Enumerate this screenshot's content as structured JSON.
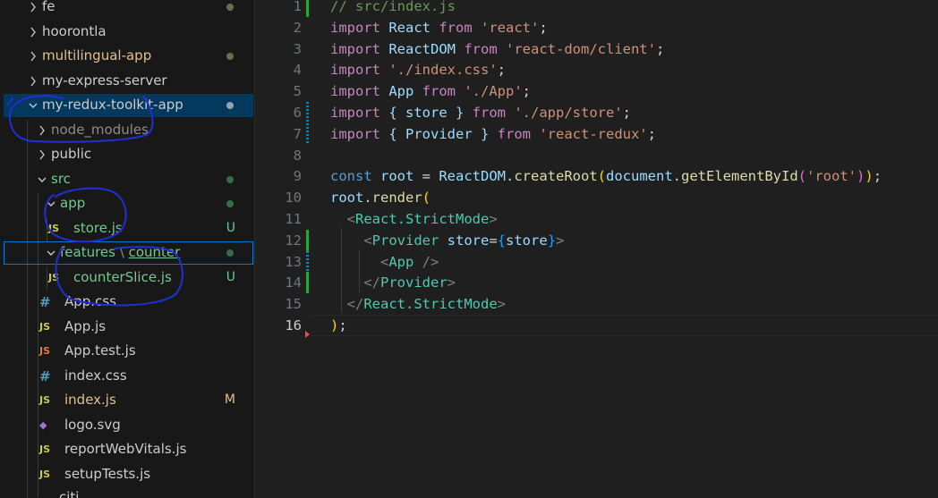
{
  "explorer": {
    "rows": [
      {
        "label": "fe",
        "kind": "folder",
        "open": false,
        "depth": 0,
        "dot": "#6f6a52"
      },
      {
        "label": "hoorontla",
        "kind": "folder",
        "open": false,
        "depth": 0
      },
      {
        "label": "multilingual-app",
        "kind": "folder",
        "open": false,
        "depth": 0,
        "dot": "#6f6a52",
        "status": "mod"
      },
      {
        "label": "my-express-server",
        "kind": "folder",
        "open": false,
        "depth": 0
      },
      {
        "label": "my-redux-toolkit-app",
        "kind": "folder",
        "open": true,
        "depth": 0,
        "dot": "#8fa5b4",
        "selected": true
      },
      {
        "label": "node_modules",
        "kind": "folder",
        "open": false,
        "depth": 1,
        "status": "dim"
      },
      {
        "label": "public",
        "kind": "folder",
        "open": false,
        "depth": 1
      },
      {
        "label": "src",
        "kind": "folder",
        "open": true,
        "depth": 1,
        "dot": "#376b4a",
        "status": "untr"
      },
      {
        "label": "app",
        "kind": "folder",
        "open": true,
        "depth": 2,
        "dot": "#376b4a",
        "status": "untr"
      },
      {
        "label": "store.js",
        "kind": "file",
        "icon": "JS",
        "iconType": "js",
        "depth": 3,
        "badge": "U",
        "status": "untr"
      },
      {
        "label": "features",
        "label2": "counter",
        "kind": "folder",
        "open": true,
        "depth": 2,
        "dot": "#376b4a",
        "status": "untr",
        "focused": true
      },
      {
        "label": "counterSlice.js",
        "kind": "file",
        "icon": "JS",
        "iconType": "js",
        "depth": 3,
        "badge": "U",
        "status": "untr"
      },
      {
        "label": "App.css",
        "kind": "file",
        "icon": "#",
        "iconType": "css",
        "depth": 2
      },
      {
        "label": "App.js",
        "kind": "file",
        "icon": "JS",
        "iconType": "js",
        "depth": 2
      },
      {
        "label": "App.test.js",
        "kind": "file",
        "icon": "JS",
        "iconType": "test",
        "depth": 2
      },
      {
        "label": "index.css",
        "kind": "file",
        "icon": "#",
        "iconType": "css",
        "depth": 2
      },
      {
        "label": "index.js",
        "kind": "file",
        "icon": "JS",
        "iconType": "js",
        "depth": 2,
        "badge": "M",
        "status": "mod"
      },
      {
        "label": "logo.svg",
        "kind": "file",
        "icon": "◆",
        "iconType": "svg",
        "depth": 2
      },
      {
        "label": "reportWebVitals.js",
        "kind": "file",
        "icon": "JS",
        "iconType": "js",
        "depth": 2
      },
      {
        "label": "setupTests.js",
        "kind": "file",
        "icon": "JS",
        "iconType": "js",
        "depth": 2
      }
    ]
  },
  "editor": {
    "current_line": 16,
    "lines": [
      {
        "n": "1",
        "git": "add",
        "tokens": [
          [
            "// src/index.js",
            "cm"
          ]
        ]
      },
      {
        "n": "2",
        "tokens": [
          [
            "import",
            "kw"
          ],
          [
            " React ",
            "id"
          ],
          [
            "from",
            "kw"
          ],
          [
            " ",
            "txt"
          ],
          [
            "'react'",
            "str"
          ],
          [
            ";",
            "txt"
          ]
        ]
      },
      {
        "n": "3",
        "tokens": [
          [
            "import",
            "kw"
          ],
          [
            " ReactDOM ",
            "id"
          ],
          [
            "from",
            "kw"
          ],
          [
            " ",
            "txt"
          ],
          [
            "'react-dom/client'",
            "str"
          ],
          [
            ";",
            "txt"
          ]
        ]
      },
      {
        "n": "4",
        "tokens": [
          [
            "import",
            "kw"
          ],
          [
            " ",
            "txt"
          ],
          [
            "'./index.css'",
            "str"
          ],
          [
            ";",
            "txt"
          ]
        ]
      },
      {
        "n": "5",
        "tokens": [
          [
            "import",
            "kw"
          ],
          [
            " App ",
            "id"
          ],
          [
            "from",
            "kw"
          ],
          [
            " ",
            "txt"
          ],
          [
            "'./App'",
            "str"
          ],
          [
            ";",
            "txt"
          ]
        ]
      },
      {
        "n": "6",
        "git": "mod",
        "tokens": [
          [
            "import",
            "kw"
          ],
          [
            " { store } ",
            "id"
          ],
          [
            "from",
            "kw"
          ],
          [
            " ",
            "txt"
          ],
          [
            "'./app/store'",
            "str"
          ],
          [
            ";",
            "txt"
          ]
        ]
      },
      {
        "n": "7",
        "git": "mod",
        "tokens": [
          [
            "import",
            "kw"
          ],
          [
            " { Provider } ",
            "id"
          ],
          [
            "from",
            "kw"
          ],
          [
            " ",
            "txt"
          ],
          [
            "'react-redux'",
            "str"
          ],
          [
            ";",
            "txt"
          ]
        ]
      },
      {
        "n": "8",
        "tokens": []
      },
      {
        "n": "9",
        "tokens": [
          [
            "const",
            "bl"
          ],
          [
            " root ",
            "id"
          ],
          [
            "= ",
            "txt"
          ],
          [
            "ReactDOM",
            "id"
          ],
          [
            ".",
            "txt"
          ],
          [
            "createRoot",
            "fn"
          ],
          [
            "(",
            "b1"
          ],
          [
            "document",
            "id"
          ],
          [
            ".",
            "txt"
          ],
          [
            "getElementById",
            "fn"
          ],
          [
            "(",
            "b2"
          ],
          [
            "'root'",
            "str"
          ],
          [
            ")",
            "b2"
          ],
          [
            ")",
            "b1"
          ],
          [
            ";",
            "txt"
          ]
        ]
      },
      {
        "n": "10",
        "tokens": [
          [
            "root",
            "id"
          ],
          [
            ".",
            "txt"
          ],
          [
            "render",
            "fn"
          ],
          [
            "(",
            "b1"
          ]
        ]
      },
      {
        "n": "11",
        "tokens": [
          [
            "  ",
            "txt"
          ],
          [
            "<",
            "pun"
          ],
          [
            "React.StrictMode",
            "tag"
          ],
          [
            ">",
            "pun"
          ]
        ]
      },
      {
        "n": "12",
        "git": "add",
        "tokens": [
          [
            "    ",
            "txt"
          ],
          [
            "<",
            "pun"
          ],
          [
            "Provider",
            "tag"
          ],
          [
            " store",
            "id"
          ],
          [
            "=",
            "txt"
          ],
          [
            "{",
            "b3"
          ],
          [
            "store",
            "id"
          ],
          [
            "}",
            "b3"
          ],
          [
            ">",
            "pun"
          ]
        ]
      },
      {
        "n": "13",
        "git": "mod",
        "tokens": [
          [
            "      ",
            "txt"
          ],
          [
            "<",
            "pun"
          ],
          [
            "App",
            "tag"
          ],
          [
            " />",
            "pun"
          ]
        ]
      },
      {
        "n": "14",
        "git": "add",
        "tokens": [
          [
            "    ",
            "txt"
          ],
          [
            "</",
            "pun"
          ],
          [
            "Provider",
            "tag"
          ],
          [
            ">",
            "pun"
          ]
        ]
      },
      {
        "n": "15",
        "tokens": [
          [
            "  ",
            "txt"
          ],
          [
            "</",
            "pun"
          ],
          [
            "React.StrictMode",
            "tag"
          ],
          [
            ">",
            "pun"
          ]
        ]
      },
      {
        "n": "16",
        "tokens": [
          [
            ")",
            "b1"
          ],
          [
            ";",
            "txt"
          ]
        ]
      }
    ]
  }
}
